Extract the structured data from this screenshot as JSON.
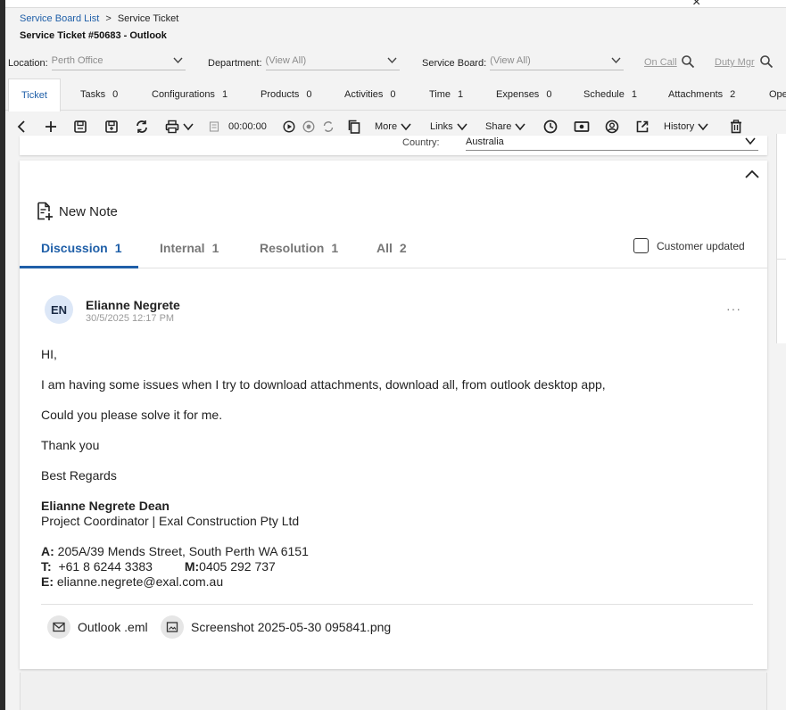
{
  "window": {
    "close_glyph": "×"
  },
  "breadcrumb": {
    "parent": "Service Board List",
    "separator": ">",
    "current": "Service Ticket"
  },
  "page_title": "Service Ticket #50683 - Outlook",
  "filters": {
    "location": {
      "label": "Location:",
      "value": "Perth Office"
    },
    "department": {
      "label": "Department:",
      "value": "(View All)"
    },
    "service_board": {
      "label": "Service Board:",
      "value": "(View All)"
    },
    "on_call": "On Call",
    "duty_mgr": "Duty Mgr"
  },
  "tabs": [
    {
      "label": "Ticket",
      "count": ""
    },
    {
      "label": "Tasks",
      "count": "0"
    },
    {
      "label": "Configurations",
      "count": "1"
    },
    {
      "label": "Products",
      "count": "0"
    },
    {
      "label": "Activities",
      "count": "0"
    },
    {
      "label": "Time",
      "count": "1"
    },
    {
      "label": "Expenses",
      "count": "0"
    },
    {
      "label": "Schedule",
      "count": "1"
    },
    {
      "label": "Attachments",
      "count": "2"
    },
    {
      "label": "Ope",
      "count": ""
    }
  ],
  "toolbar": {
    "timer": "00:00:00",
    "more": "More",
    "links": "Links",
    "share": "Share",
    "history": "History"
  },
  "country": {
    "label": "Country:",
    "value": "Australia"
  },
  "note": {
    "heading": "New Note",
    "tabs": [
      {
        "label": "Discussion",
        "count": "1"
      },
      {
        "label": "Internal",
        "count": "1"
      },
      {
        "label": "Resolution",
        "count": "1"
      },
      {
        "label": "All",
        "count": "2"
      }
    ],
    "customer_updated": "Customer updated"
  },
  "entry": {
    "initials": "EN",
    "author": "Elianne Negrete",
    "timestamp": "30/5/2025 12:17 PM",
    "more": "···",
    "lines": [
      "HI,",
      "I am having some issues when I try to download attachments, download all,  from outlook desktop app,",
      "Could you please solve it for me.",
      "Thank you",
      "Best Regards"
    ],
    "signature": {
      "name": "Elianne Negrete Dean",
      "role": "Project Coordinator | Exal Construction Pty Ltd",
      "address_label": "A:",
      "address": "205A/39 Mends Street, South Perth WA 6151",
      "phone_label": "T:",
      "phone": "+61 8 6244 3383",
      "mobile_label": "M:",
      "mobile": "0405 292 737",
      "email_label": "E:",
      "email": "elianne.negrete@exal.com.au"
    },
    "attachments": [
      {
        "name": "Outlook .eml",
        "icon": "email-icon"
      },
      {
        "name": "Screenshot 2025-05-30 095841.png",
        "icon": "image-icon"
      }
    ]
  }
}
